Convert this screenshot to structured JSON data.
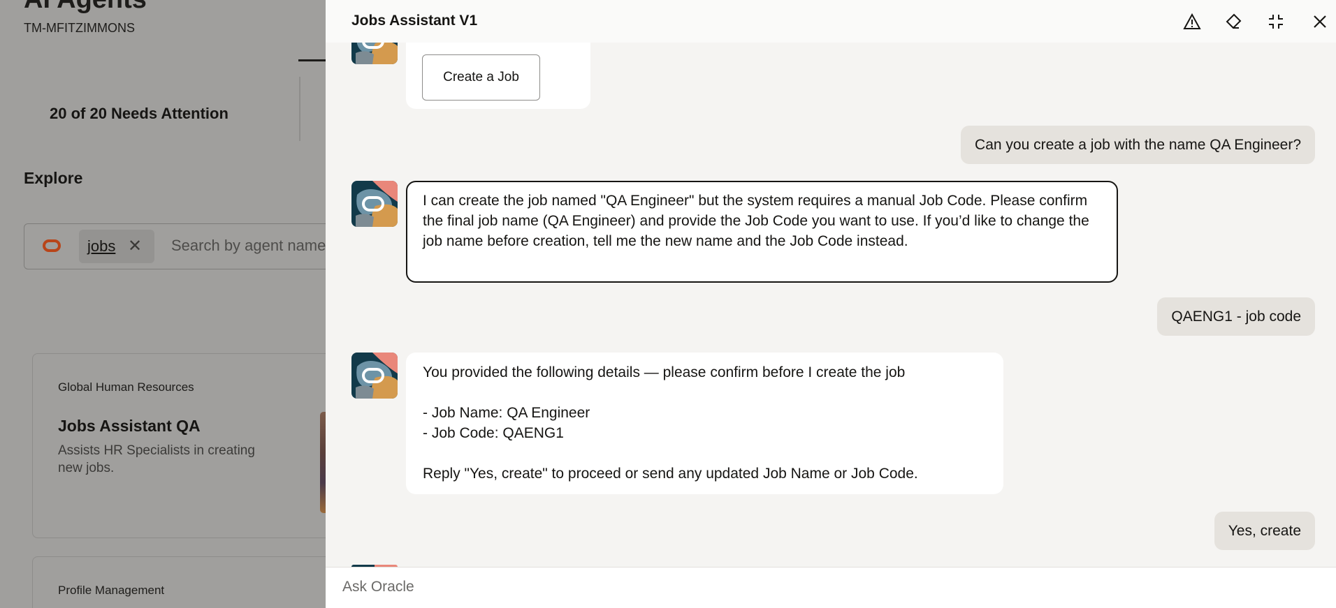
{
  "left": {
    "app_title": "AI Agents",
    "user_id": "TM-MFITZIMMONS",
    "attention": "20 of 20 Needs Attention",
    "explore": "Explore",
    "search": {
      "chip": "jobs",
      "placeholder": "Search by agent name"
    },
    "cards": [
      {
        "org": "Global Human Resources",
        "name": "Jobs Assistant QA",
        "desc": "Assists HR Specialists in creating new jobs."
      },
      {
        "org": "Profile Management"
      }
    ]
  },
  "panel": {
    "title": "Jobs Assistant V1",
    "icons": [
      "warning-icon",
      "eraser-icon",
      "minimize-icon",
      "close-icon"
    ],
    "messages": [
      {
        "role": "bot",
        "button": "Create a Job"
      },
      {
        "role": "user",
        "text": "Can you create a job with the name QA Engineer?"
      },
      {
        "role": "bot",
        "text": "I can create the job named \"QA Engineer\" but the system requires a manual Job Code. Please confirm the final job name (QA Engineer) and provide the Job Code you want to use. If you’d like to change the job name before creation, tell me the new name and the Job Code instead."
      },
      {
        "role": "user",
        "text": "QAENG1 - job code"
      },
      {
        "role": "bot",
        "text": "You provided the following details — please confirm before I create the job\n\n- Job Name: QA Engineer\n- Job Code: QAENG1\n\nReply \"Yes, create\" to proceed or send any updated Job Name or Job Code."
      },
      {
        "role": "user",
        "text": "Yes, create"
      }
    ],
    "input_placeholder": "Ask Oracle"
  },
  "colors": {
    "accent": "#b8451a",
    "panel_bg": "#f5f4f2",
    "user_bubble": "#e5e2dd"
  }
}
